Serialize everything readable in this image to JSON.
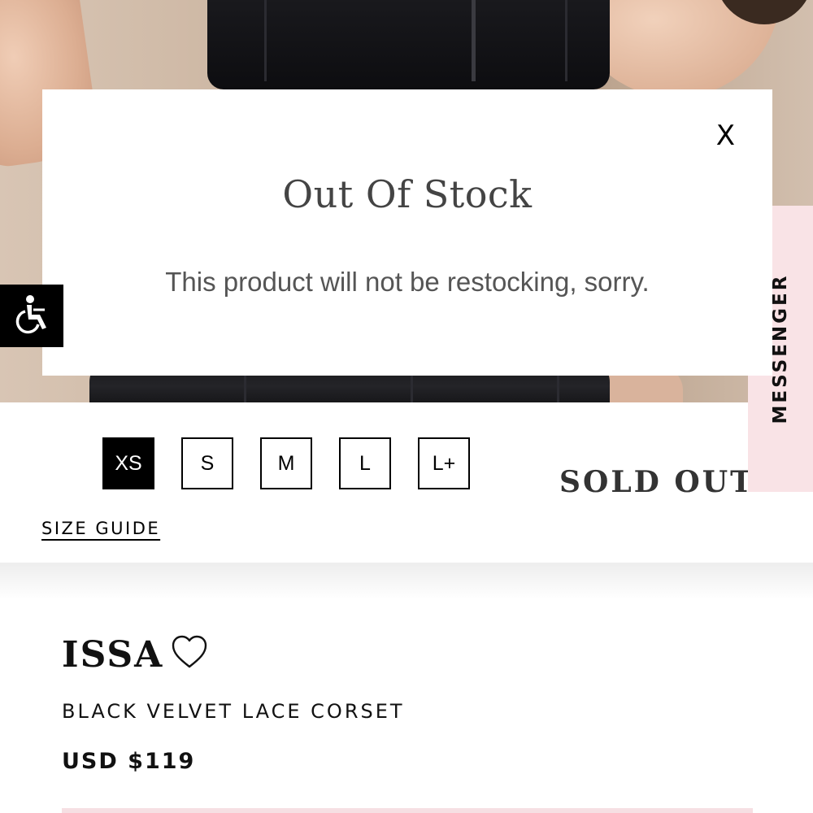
{
  "modal": {
    "title": "Out Of Stock",
    "message": "This product will not be restocking, sorry.",
    "close_label": "X"
  },
  "sizes": [
    {
      "label": "XS",
      "selected": true
    },
    {
      "label": "S",
      "selected": false
    },
    {
      "label": "M",
      "selected": false
    },
    {
      "label": "L",
      "selected": false
    },
    {
      "label": "L+",
      "selected": false
    }
  ],
  "sold_out_label": "SOLD OUT",
  "size_guide_label": "SIZE GUIDE",
  "messenger_label": "MESSENGER",
  "product": {
    "brand": "ISSA",
    "name": "BLACK VELVET LACE CORSET",
    "price": "USD $119"
  },
  "icons": {
    "accessibility": "wheelchair-icon",
    "wishlist": "heart-outline-icon",
    "close": "close-icon"
  },
  "colors": {
    "messenger_bg": "#f9e3e6",
    "modal_title": "#444444",
    "selected_size_bg": "#000000"
  }
}
